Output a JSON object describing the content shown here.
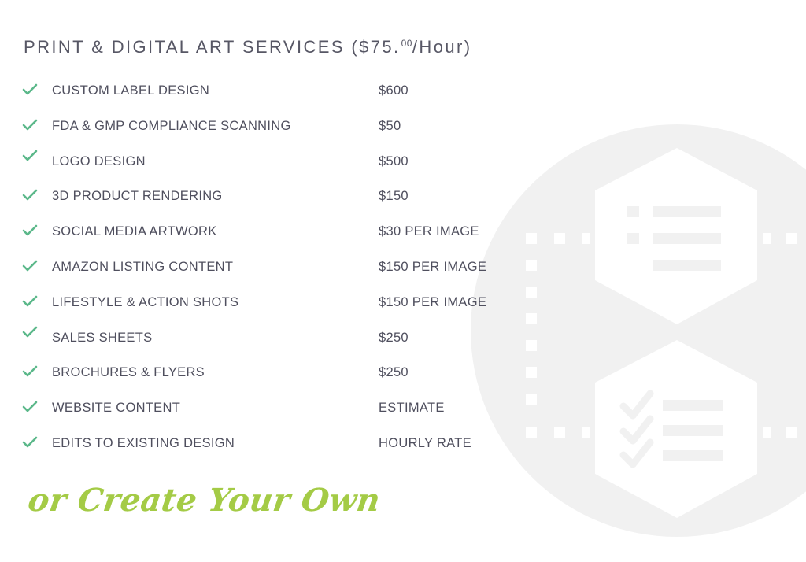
{
  "header": {
    "title": "PRINT & DIGITAL ART SERVICES ($75.",
    "title_sup": "00",
    "title_end": "/Hour)"
  },
  "services": [
    {
      "name": "CUSTOM LABEL DESIGN",
      "price": "$600"
    },
    {
      "name": "FDA & GMP COMPLIANCE SCANNING",
      "price": "$50"
    },
    {
      "name": "LOGO DESIGN",
      "price": "$500"
    },
    {
      "name": "3D PRODUCT RENDERING",
      "price": "$150"
    },
    {
      "name": "SOCIAL MEDIA ARTWORK",
      "price": "$30 PER IMAGE"
    },
    {
      "name": "AMAZON LISTING CONTENT",
      "price": "$150 PER IMAGE"
    },
    {
      "name": "LIFESTYLE & ACTION SHOTS",
      "price": "$150 PER IMAGE"
    },
    {
      "name": "SALES SHEETS",
      "price": "$250"
    },
    {
      "name": "BROCHURES & FLYERS",
      "price": "$250"
    },
    {
      "name": "WEBSITE CONTENT",
      "price": "ESTIMATE"
    },
    {
      "name": "EDITS TO EXISTING DESIGN",
      "price": "HOURLY RATE"
    }
  ],
  "tagline": "or Create Your Own",
  "colors": {
    "check": "#5bb88a",
    "text": "#4f4f5e",
    "tagline": "#a4cb46",
    "graphic": "#f1f1f1"
  },
  "icons": {
    "bullet": "check-icon",
    "background": "checklist-hexagon-graphic"
  }
}
